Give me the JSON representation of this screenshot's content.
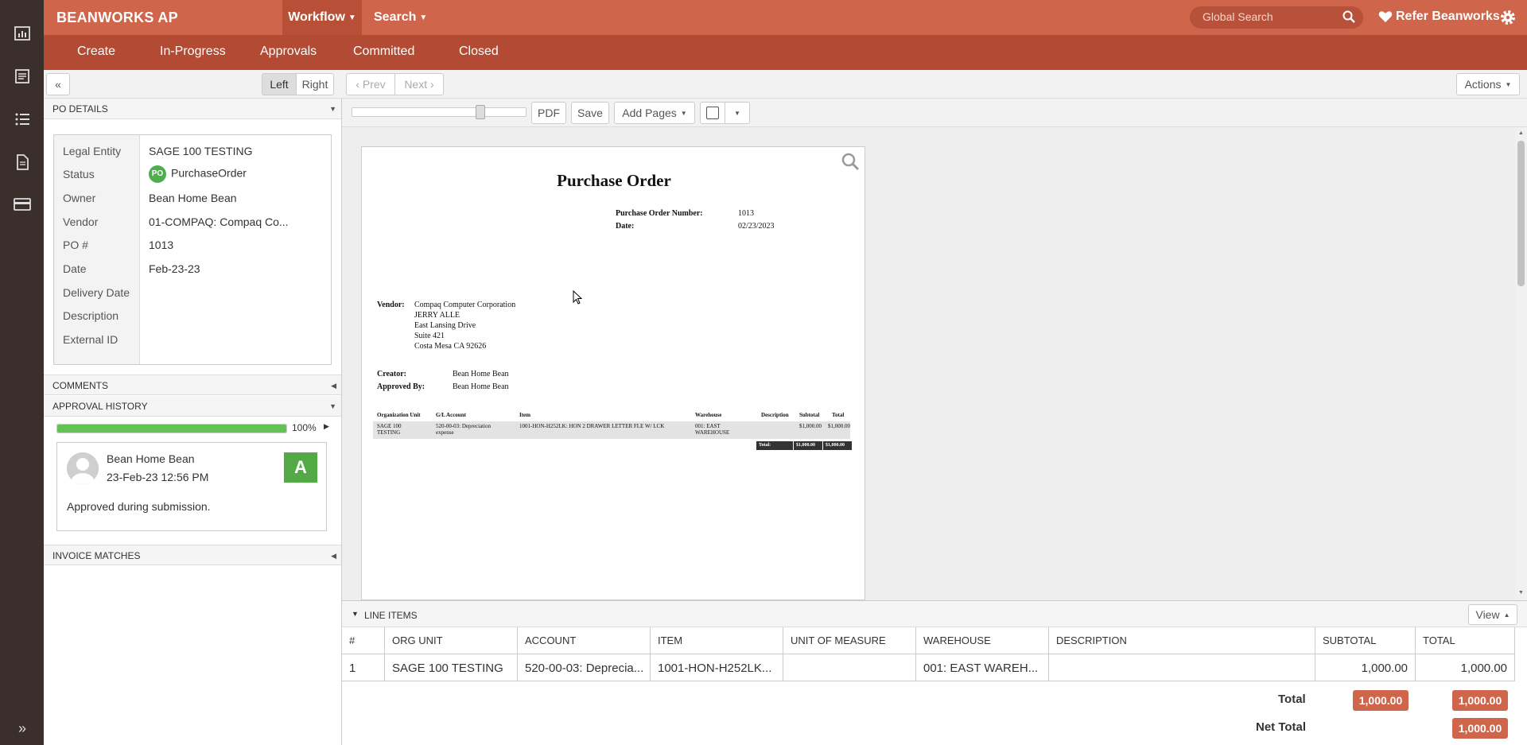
{
  "header": {
    "brand": "BEANWORKS AP",
    "nav_workflow": "Workflow",
    "nav_search": "Search",
    "search_placeholder": "Global Search",
    "refer": "Refer Beanworks"
  },
  "subnav": [
    "Create",
    "In-Progress",
    "Approvals",
    "Committed",
    "Closed"
  ],
  "toolbar": {
    "collapse": "«",
    "left": "Left",
    "right": "Right",
    "prev": "Prev",
    "next": "Next",
    "actions": "Actions"
  },
  "viewer_toolbar": {
    "pdf": "PDF",
    "save": "Save",
    "add_pages": "Add Pages"
  },
  "po_details": {
    "title": "PO DETAILS",
    "fields": [
      {
        "label": "Legal Entity",
        "value": "SAGE 100 TESTING"
      },
      {
        "label": "Status",
        "value": "PurchaseOrder",
        "badge": "PO"
      },
      {
        "label": "Owner",
        "value": "Bean Home Bean"
      },
      {
        "label": "Vendor",
        "value": "01-COMPAQ: Compaq Co..."
      },
      {
        "label": "PO #",
        "value": "1013"
      },
      {
        "label": "Date",
        "value": "Feb-23-23"
      },
      {
        "label": "Delivery Date",
        "value": ""
      },
      {
        "label": "Description",
        "value": ""
      },
      {
        "label": "External ID",
        "value": ""
      }
    ]
  },
  "comments": {
    "title": "COMMENTS"
  },
  "approval_history": {
    "title": "APPROVAL HISTORY",
    "progress": 100,
    "progress_label": "100%",
    "approver": "Bean Home Bean",
    "date": "23-Feb-23 12:56 PM",
    "badge": "A",
    "note": "Approved during submission."
  },
  "invoice_matches": {
    "title": "INVOICE MATCHES"
  },
  "document": {
    "title": "Purchase Order",
    "po_number_label": "Purchase Order Number:",
    "po_number": "1013",
    "date_label": "Date:",
    "date": "02/23/2023",
    "vendor_label": "Vendor:",
    "vendor_lines": [
      "Compaq Computer Corporation",
      "JERRY ALLE",
      "East Lansing Drive",
      "Suite 421",
      "Costa Mesa CA  92626"
    ],
    "creator_label": "Creator:",
    "creator": "Bean Home Bean",
    "approved_label": "Approved By:",
    "approved": "Bean Home Bean",
    "table_headers": [
      "Organization Unit",
      "G/L Account",
      "Item",
      "Warehouse",
      "Description",
      "Subtotal",
      "Total"
    ],
    "row": {
      "org": "SAGE 100 TESTING",
      "gl": "520-00-03: Depreciation expense",
      "item": "1001-HON-H252LK: HON 2 DRAWER LETTER FLE W/ LCK",
      "warehouse": "001: EAST WAREHOUSE",
      "description": "",
      "subtotal": "$1,000.00",
      "total": "$1,000.00"
    },
    "total_label": "Total:",
    "total_subtotal": "$1,000.00",
    "total_total": "$1,000.00"
  },
  "line_items": {
    "title": "LINE ITEMS",
    "view": "View",
    "columns": [
      "#",
      "ORG UNIT",
      "ACCOUNT",
      "ITEM",
      "UNIT OF MEASURE",
      "WAREHOUSE",
      "DESCRIPTION",
      "SUBTOTAL",
      "TOTAL"
    ],
    "rows": [
      [
        "1",
        "SAGE 100 TESTING",
        "520-00-03: Deprecia...",
        "1001-HON-H252LK...",
        "",
        "001: EAST WAREH...",
        "",
        "1,000.00",
        "1,000.00"
      ]
    ],
    "total_label": "Total",
    "total_subtotal": "1,000.00",
    "total_total": "1,000.00",
    "net_total_label": "Net Total",
    "net_total": "1,000.00"
  }
}
